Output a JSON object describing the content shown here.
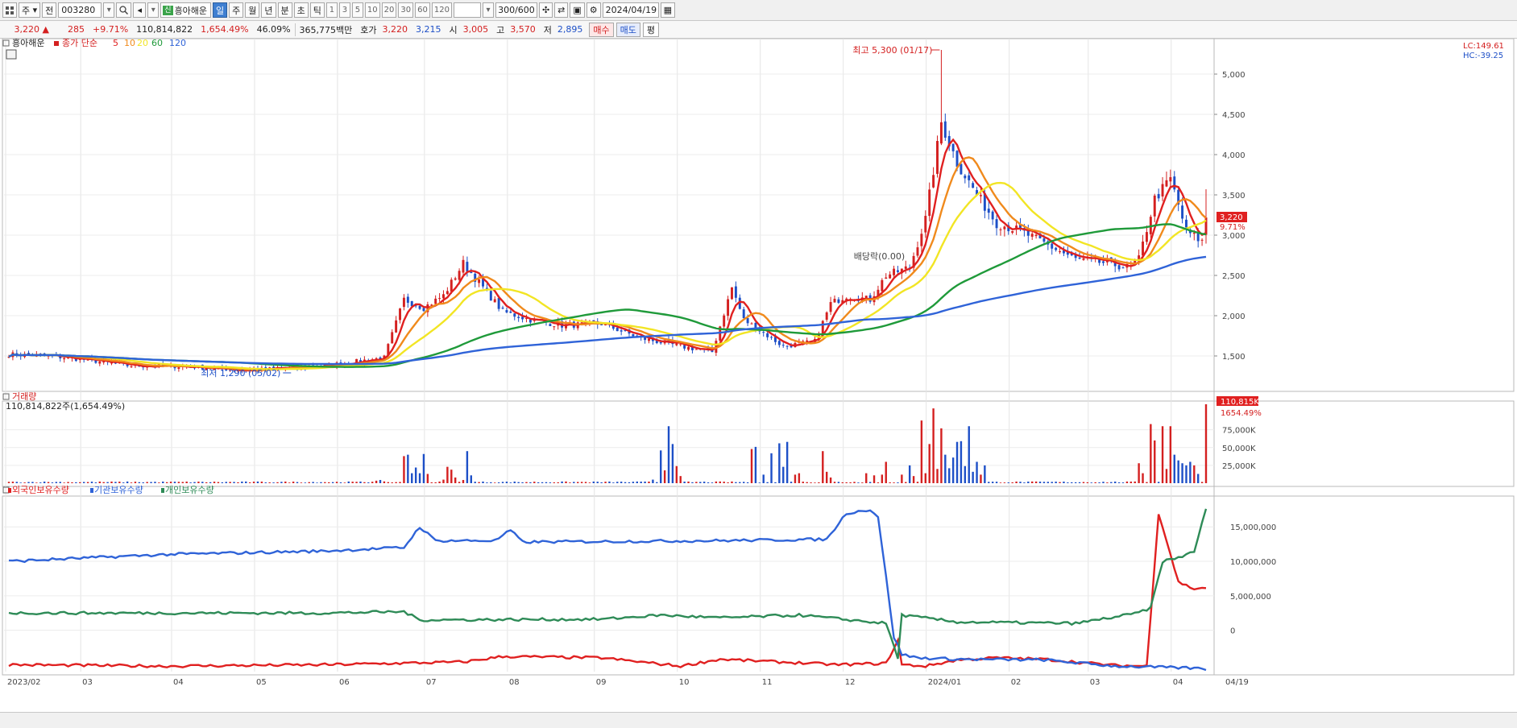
{
  "toolbar": {
    "menu_icon": "grid-menu-icon",
    "period_select": "주",
    "market_select": "전",
    "stock_code": "003280",
    "search_icon": "search-icon",
    "stock_badge": "신",
    "stock_name": "흥아해운",
    "period_tabs": [
      "일",
      "주",
      "월",
      "년",
      "분",
      "초",
      "틱"
    ],
    "active_period": "일",
    "interval_buttons": [
      "1",
      "3",
      "5",
      "10",
      "20",
      "30",
      "60",
      "120"
    ],
    "count_value": "300/600",
    "date_value": "2024/04/19"
  },
  "quote": {
    "price": "3,220 ▲",
    "change": "285",
    "change_pct": "+9.71%",
    "volume": "110,814,822",
    "volume_ratio": "1,654.49%",
    "turnover": "46.09%",
    "amount": "365,775백만",
    "ask_label": "호가",
    "ask": "3,220",
    "bid": "3,215",
    "open_label": "시",
    "open": "3,005",
    "high_label": "고",
    "high": "3,570",
    "low_label": "저",
    "low": "2,895",
    "buy_button": "매수",
    "sell_button": "매도",
    "eval_button": "평"
  },
  "panels": {
    "price_title": "흥아해운",
    "ma_label": "종가 단순",
    "volume_title": "거래량",
    "volume_info": "110,814,822주(1,654.49%)",
    "holdings_titles": [
      "외국인보유수량",
      "기관보유수량",
      "개인보유수량"
    ]
  },
  "colors": {
    "up": "#d42020",
    "down": "#1d4fc7",
    "ma5": "#e02020",
    "ma10": "#f08a1c",
    "ma20": "#f2e524",
    "ma60": "#1f9a3a",
    "ma120": "#2f63d8",
    "foreign": "#e02020",
    "institution": "#2f63d8",
    "individual": "#2e8b57"
  },
  "chart_data": [
    {
      "type": "candlestick",
      "title": "흥아해운",
      "x_ticks": [
        "2023/02",
        "03",
        "04",
        "05",
        "06",
        "07",
        "08",
        "09",
        "10",
        "11",
        "12",
        "2024/01",
        "02",
        "03",
        "04"
      ],
      "last_date": "04/19",
      "y_ticks": [
        1500,
        2000,
        2500,
        3000,
        3500,
        4000,
        4500,
        5000
      ],
      "ylim": [
        1100,
        5400
      ],
      "moving_averages": [
        {
          "name": "5",
          "period": 5
        },
        {
          "name": "10",
          "period": 10
        },
        {
          "name": "20",
          "period": 20
        },
        {
          "name": "60",
          "period": 60
        },
        {
          "name": "120",
          "period": 120
        }
      ],
      "annotations": [
        {
          "text": "최고 5,300 (01/17)",
          "date_index": 236,
          "value": 5300
        },
        {
          "text": "최저 1,290 (05/02)",
          "date_index": 60,
          "value": 1290
        },
        {
          "text": "배당락(0.00)",
          "date_index": 222,
          "value": 2700
        }
      ],
      "last_close_label": "3,220",
      "last_change_label": "9.71%",
      "top_right_labels": [
        "LC:149.61",
        "HC:-39.25"
      ],
      "anchors": [
        [
          0,
          1520
        ],
        [
          10,
          1500
        ],
        [
          20,
          1450
        ],
        [
          30,
          1380
        ],
        [
          45,
          1370
        ],
        [
          60,
          1320
        ],
        [
          80,
          1380
        ],
        [
          95,
          1480
        ],
        [
          100,
          2200
        ],
        [
          105,
          2100
        ],
        [
          110,
          2250
        ],
        [
          115,
          2650
        ],
        [
          120,
          2350
        ],
        [
          125,
          2050
        ],
        [
          132,
          1950
        ],
        [
          140,
          1880
        ],
        [
          150,
          1900
        ],
        [
          160,
          1720
        ],
        [
          170,
          1620
        ],
        [
          178,
          1550
        ],
        [
          183,
          2350
        ],
        [
          186,
          1950
        ],
        [
          190,
          1820
        ],
        [
          196,
          1620
        ],
        [
          204,
          1680
        ],
        [
          208,
          2150
        ],
        [
          212,
          2250
        ],
        [
          218,
          2200
        ],
        [
          222,
          2500
        ],
        [
          228,
          2600
        ],
        [
          232,
          3200
        ],
        [
          236,
          4400
        ],
        [
          240,
          3900
        ],
        [
          245,
          3500
        ],
        [
          250,
          3150
        ],
        [
          256,
          3050
        ],
        [
          262,
          2900
        ],
        [
          270,
          2700
        ],
        [
          278,
          2650
        ],
        [
          283,
          2600
        ],
        [
          286,
          2700
        ],
        [
          290,
          3450
        ],
        [
          294,
          3700
        ],
        [
          298,
          3050
        ],
        [
          302,
          2920
        ],
        [
          303,
          3220
        ]
      ]
    },
    {
      "type": "bar",
      "title": "거래량",
      "y_ticks": [
        25000,
        50000,
        75000
      ],
      "y_tick_labels": [
        "25,000K",
        "50,000K",
        "75,000K"
      ],
      "ylim": [
        0,
        110815
      ],
      "last_value_label": "110,815K",
      "last_ratio_label": "1654.49%",
      "spikes": [
        [
          92,
          2000
        ],
        [
          93,
          3500
        ],
        [
          94,
          4500
        ],
        [
          95,
          2500
        ],
        [
          96,
          1500
        ],
        [
          100,
          38000
        ],
        [
          101,
          40000
        ],
        [
          102,
          14000
        ],
        [
          103,
          22000
        ],
        [
          104,
          14000
        ],
        [
          105,
          41000
        ],
        [
          106,
          13000
        ],
        [
          110,
          5000
        ],
        [
          111,
          23000
        ],
        [
          112,
          19000
        ],
        [
          113,
          8000
        ],
        [
          115,
          4500
        ],
        [
          116,
          45000
        ],
        [
          117,
          11000
        ],
        [
          163,
          5000
        ],
        [
          165,
          46000
        ],
        [
          166,
          18000
        ],
        [
          167,
          80000
        ],
        [
          168,
          55000
        ],
        [
          169,
          24000
        ],
        [
          170,
          10000
        ],
        [
          188,
          48000
        ],
        [
          189,
          51000
        ],
        [
          191,
          12000
        ],
        [
          193,
          42000
        ],
        [
          195,
          56000
        ],
        [
          196,
          23000
        ],
        [
          197,
          58000
        ],
        [
          199,
          12000
        ],
        [
          200,
          14000
        ],
        [
          206,
          45000
        ],
        [
          207,
          16000
        ],
        [
          208,
          8000
        ],
        [
          217,
          14000
        ],
        [
          219,
          11000
        ],
        [
          221,
          12000
        ],
        [
          222,
          30000
        ],
        [
          226,
          12000
        ],
        [
          228,
          25000
        ],
        [
          229,
          10000
        ],
        [
          231,
          88000
        ],
        [
          232,
          14000
        ],
        [
          233,
          55000
        ],
        [
          234,
          105000
        ],
        [
          235,
          20000
        ],
        [
          236,
          77000
        ],
        [
          237,
          40000
        ],
        [
          238,
          21000
        ],
        [
          239,
          36000
        ],
        [
          240,
          58000
        ],
        [
          241,
          59000
        ],
        [
          242,
          24000
        ],
        [
          243,
          80000
        ],
        [
          244,
          16000
        ],
        [
          245,
          30000
        ],
        [
          246,
          12000
        ],
        [
          247,
          25000
        ],
        [
          286,
          28000
        ],
        [
          287,
          14000
        ],
        [
          289,
          83000
        ],
        [
          290,
          60000
        ],
        [
          292,
          80000
        ],
        [
          293,
          20000
        ],
        [
          294,
          80000
        ],
        [
          295,
          40000
        ],
        [
          296,
          32000
        ],
        [
          297,
          28000
        ],
        [
          298,
          25000
        ],
        [
          299,
          30000
        ],
        [
          300,
          25000
        ],
        [
          301,
          13000
        ],
        [
          303,
          110815
        ]
      ]
    },
    {
      "type": "line",
      "title": "외국인보유수량 / 기관보유수량 / 개인보유수량",
      "y_ticks": [
        0,
        5000000,
        10000000,
        15000000
      ],
      "y_tick_labels": [
        "0",
        "5,000,000",
        "10,000,000",
        "15,000,000"
      ],
      "ylim": [
        -6000000,
        19000000
      ],
      "series": [
        {
          "name": "외국인보유수량",
          "anchors": [
            [
              0,
              -5000000
            ],
            [
              40,
              -5200000
            ],
            [
              80,
              -5000000
            ],
            [
              115,
              -4600000
            ],
            [
              125,
              -3800000
            ],
            [
              150,
              -4000000
            ],
            [
              170,
              -5200000
            ],
            [
              180,
              -4200000
            ],
            [
              210,
              -5000000
            ],
            [
              222,
              -4800000
            ],
            [
              225,
              -1500000
            ],
            [
              226,
              -5000000
            ],
            [
              232,
              -5200000
            ],
            [
              240,
              -4300000
            ],
            [
              250,
              -4000000
            ],
            [
              262,
              -4200000
            ],
            [
              280,
              -5100000
            ],
            [
              288,
              -5200000
            ],
            [
              291,
              17000000
            ],
            [
              296,
              7000000
            ],
            [
              300,
              6000000
            ],
            [
              303,
              6200000
            ]
          ]
        },
        {
          "name": "기관보유수량",
          "anchors": [
            [
              0,
              10000000
            ],
            [
              40,
              11000000
            ],
            [
              80,
              11500000
            ],
            [
              100,
              12000000
            ],
            [
              104,
              15000000
            ],
            [
              108,
              13000000
            ],
            [
              123,
              13000000
            ],
            [
              127,
              14500000
            ],
            [
              130,
              12800000
            ],
            [
              180,
              13000000
            ],
            [
              207,
              13200000
            ],
            [
              212,
              17000000
            ],
            [
              218,
              17500000
            ],
            [
              220,
              16500000
            ],
            [
              224,
              -1000000
            ],
            [
              226,
              -3500000
            ],
            [
              230,
              -4000000
            ],
            [
              240,
              -4200000
            ],
            [
              262,
              -4300000
            ],
            [
              280,
              -5200000
            ],
            [
              300,
              -5500000
            ],
            [
              303,
              -5600000
            ]
          ]
        },
        {
          "name": "개인보유수량",
          "anchors": [
            [
              0,
              2500000
            ],
            [
              80,
              2500000
            ],
            [
              100,
              2700000
            ],
            [
              104,
              1500000
            ],
            [
              150,
              1600000
            ],
            [
              165,
              2200000
            ],
            [
              180,
              1800000
            ],
            [
              200,
              2200000
            ],
            [
              222,
              1000000
            ],
            [
              225,
              -4000000
            ],
            [
              226,
              2200000
            ],
            [
              240,
              1200000
            ],
            [
              270,
              1000000
            ],
            [
              285,
              2400000
            ],
            [
              289,
              3200000
            ],
            [
              292,
              10000000
            ],
            [
              296,
              10500000
            ],
            [
              300,
              11500000
            ],
            [
              303,
              17500000
            ]
          ]
        }
      ]
    }
  ]
}
